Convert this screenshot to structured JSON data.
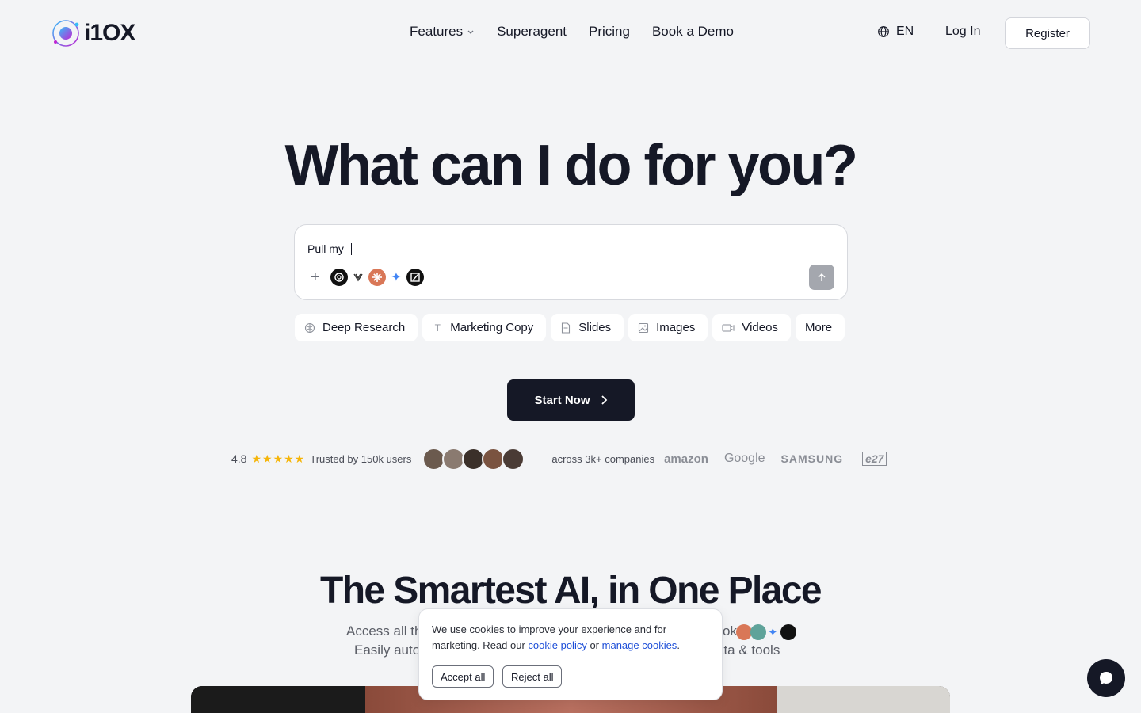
{
  "header": {
    "logo_text": "i1OX",
    "nav": [
      {
        "label": "Features",
        "has_dropdown": true
      },
      {
        "label": "Superagent"
      },
      {
        "label": "Pricing"
      },
      {
        "label": "Book a Demo"
      }
    ],
    "language": "EN",
    "login_label": "Log In",
    "register_label": "Register"
  },
  "hero": {
    "title": "What can I do for you?",
    "prompt_value": "Pull my ",
    "add_icon": "plus-icon",
    "send_icon": "arrow-up-icon",
    "models": [
      "openai-icon",
      "openrouter-icon",
      "claude-icon",
      "gemini-icon",
      "grok-icon"
    ],
    "chips": [
      {
        "label": "Deep Research",
        "icon": "brain-icon"
      },
      {
        "label": "Marketing Copy",
        "icon": "text-icon"
      },
      {
        "label": "Slides",
        "icon": "document-icon"
      },
      {
        "label": "Images",
        "icon": "image-icon"
      },
      {
        "label": "Videos",
        "icon": "video-icon"
      },
      {
        "label": "More",
        "icon": ""
      }
    ],
    "cta_label": "Start Now"
  },
  "trust": {
    "rating": "4.8",
    "trusted_text": "Trusted by 150k users",
    "companies_text": "across 3k+ companies",
    "brands": [
      "amazon",
      "Google",
      "SAMSUNG",
      "e27"
    ]
  },
  "section": {
    "title": "The Smartest AI, in One Place",
    "subtitle_line1_start": "Access all th",
    "subtitle_line1_end": "ok",
    "subtitle_line2_start": "Easily auto",
    "subtitle_line2_end": "ata & tools"
  },
  "cookie": {
    "text_before": "We use cookies to improve your experience and for marketing. Read our ",
    "policy_link": "cookie policy",
    "text_or": " or ",
    "manage_link": "manage cookies",
    "text_end": ".",
    "accept_label": "Accept all",
    "reject_label": "Reject all"
  },
  "colors": {
    "background": "#f3f4f6",
    "primary": "#151826",
    "star": "#f5b50a",
    "link": "#1d4ed8"
  }
}
